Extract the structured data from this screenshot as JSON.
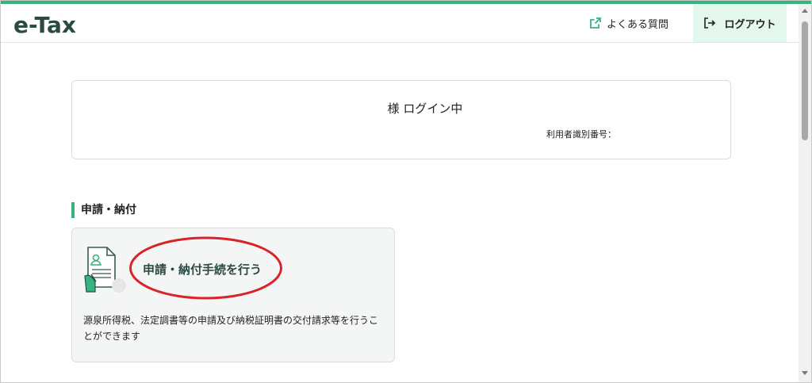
{
  "header": {
    "logo": "e-Tax",
    "faq_label": "よくある質問",
    "logout_label": "ログアウト"
  },
  "user_card": {
    "login_status": "様 ログイン中",
    "user_id_label": "利用者識別番号："
  },
  "section": {
    "title": "申請・納付"
  },
  "procedure_card": {
    "title": "申請・納付手続を行う",
    "description": "源泉所得税、法定調書等の申請及び納税証明書の交付請求等を行うことができます"
  },
  "colors": {
    "accent": "#36b37e",
    "logout_bg": "#e3f7ec",
    "logo": "#2c4a44",
    "highlight": "#d9232a"
  },
  "icons": {
    "faq": "external-link-icon",
    "logout": "logout-icon",
    "procedure": "document-person-icon"
  }
}
